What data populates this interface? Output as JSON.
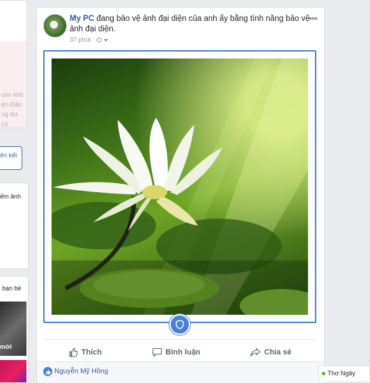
{
  "left_column": {
    "faded_lines": [
      "con khô",
      "ện Đảo",
      "ng dự",
      "có"
    ],
    "button_label": "ên kết",
    "card2_text": "ếm ảnh",
    "card3_label": "bạn bè",
    "thumb_caption": "mới"
  },
  "post": {
    "author": "My PC",
    "text": " đang bảo vệ ảnh đại diện của anh ấy bằng tính năng bảo vệ ảnh đại diện.",
    "time": "37 phút",
    "separator": "·",
    "more_icon": "more-dots-icon",
    "privacy_icon": "globe-icon",
    "accent_color": "#4a7fd4",
    "link_color": "#365899"
  },
  "actions": {
    "like_label": "Thích",
    "comment_label": "Bình luận",
    "share_label": "Chia sẻ"
  },
  "reactions": {
    "name": "Nguyễn Mỹ Hồng",
    "icon": "thumbs-up-icon"
  },
  "chat": {
    "name": "Thơ Ngây",
    "status_color": "#42b72a"
  }
}
